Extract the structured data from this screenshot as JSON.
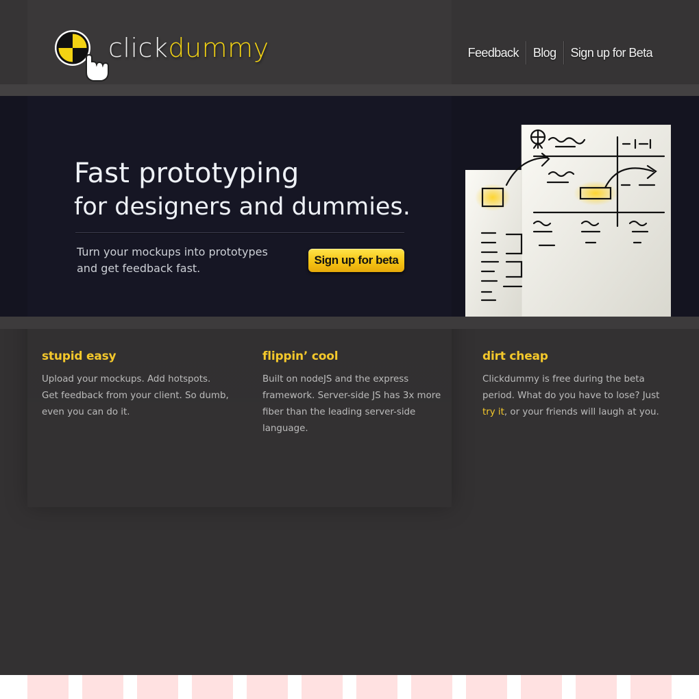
{
  "header": {
    "logo_word1": "click",
    "logo_word2": "dummy",
    "nav": [
      {
        "label": "Feedback"
      },
      {
        "label": "Blog"
      },
      {
        "label": "Sign up for Beta"
      }
    ]
  },
  "hero": {
    "title_line1": "Fast prototyping",
    "title_line2": "for designers and dummies.",
    "subtitle_line1": "Turn your mockups into prototypes",
    "subtitle_line2": "and get feedback fast.",
    "cta_label": "Sign up for beta"
  },
  "features": [
    {
      "title": "stupid easy",
      "lines": [
        "Upload your mockups. Add hotspots.",
        "Get feedback from your client. So dumb,",
        "even you can do it."
      ]
    },
    {
      "title": "flippin’ cool",
      "lines": [
        "Built on nodeJS and the express",
        "framework. Server-side JS has 3x more",
        "fiber than the leading server-side",
        "language."
      ]
    },
    {
      "title": "dirt cheap",
      "line1": "Clickdummy is free during the beta",
      "line2": "period. What do you have to lose? Just",
      "link": "try it",
      "line3_rest": ", or your friends will laugh at you."
    }
  ],
  "colors": {
    "accent": "#f4c82b",
    "background": "#333132",
    "hero_bg": "#141420"
  },
  "icons": {
    "logo": "crash-test-dummy-cursor-icon",
    "hero_art": "wireframe-sketch-illustration"
  }
}
